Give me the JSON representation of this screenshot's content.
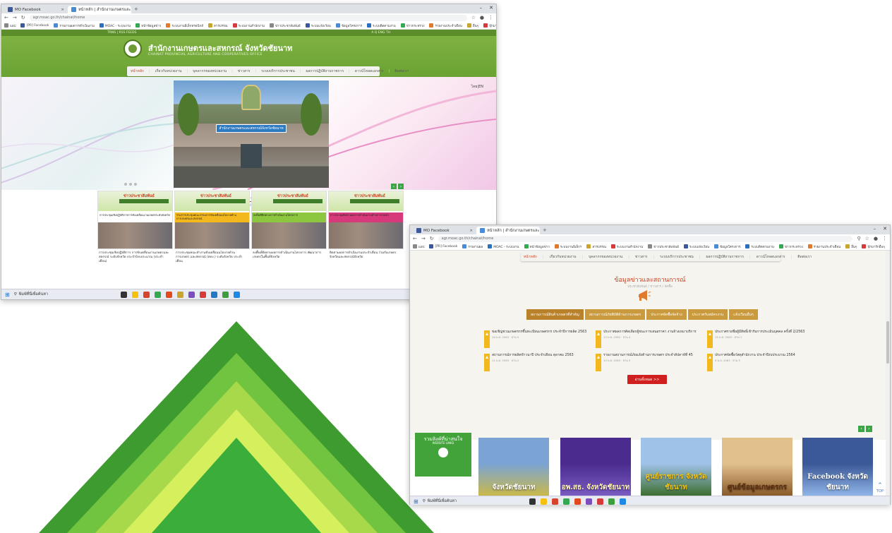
{
  "win1": {
    "tabs": [
      {
        "label": "MO Facebook",
        "active": false,
        "color": "#3b5998"
      },
      {
        "label": "หน้าหลัก | สำนักงานเกษตรและสหกรณ์",
        "active": true,
        "color": "#4a8bd6"
      }
    ],
    "url": "agr.moac.go.th/chainat/home",
    "bookmarks": [
      "แอป",
      "[PR] Facebook",
      "รายงานผลการดำเนินงาน",
      "MOAC - ระบบงาน",
      "หน้าข้อมูลข่าว",
      "ระบบงานอิเล็กทรอนิกส์",
      "สารบรรณ",
      "ระบบงานสำนักงาน",
      "ข่าวประชาสัมพันธ์",
      "ระบบแจ้งเวียน",
      "ข้อมูลโครงการ",
      "ระบบติดตามงาน",
      "ข่าวกระทรวง",
      "รายงานประจำเดือน",
      "อื่นๆ",
      "บุ๊กมาร์กอื่นๆ"
    ],
    "site": {
      "topstrip_left": "TRNS | RSS FEEDS",
      "topstrip_right": "A Q ENG TH",
      "title": "สำนักงานเกษตรและสหกรณ์ จังหวัดชัยนาท",
      "subtitle": "CHAINAT PROVINCIAL AGRICULTURE AND COOPERATIVES OFFICE",
      "menu": [
        "หน้าหลัก",
        "เกี่ยวกับหน่วยงาน",
        "บุคลากรของหน่วยงาน",
        "ข่าวสาร",
        "ระบบบริการประชาชน",
        "ผลการปฏิบัติงานราชการ",
        "ดาวน์โหลดเอกสาร",
        "ติดต่อเรา"
      ],
      "lang": "ไทย|EN",
      "photo_sign": "สำนักงานเกษตรและสหกรณ์จังหวัดชัยนาท",
      "news_title": "ข่าวประชาสัมพันธ์",
      "news_sub": "NEWS",
      "cards": [
        {
          "banner": "ข่าวประชาสัมพันธ์",
          "strip": "การประชุมเชิงปฏิบัติการการขับเคลื่อนงานเกษตรระดับจังหวัด",
          "strip_color": "#ffffff",
          "caption": "การประชุมเชิงปฏิบัติการ การขับเคลื่อนงานเกษตรและสหกรณ์ ระดับจังหวัด ประจำปีงบประมาณ (ประจำเดือน)"
        },
        {
          "banner": "ข่าวประชาสัมพันธ์",
          "strip": "ร่วมการประชุมคณะกรรมการขับเคลื่อนนโยบายด้านการเกษตรและสหกรณ์",
          "strip_color": "#f3b81d",
          "caption": "การประชุมคณะทำงานขับเคลื่อนนโยบายด้านการเกษตร และสหกรณ์ (คทง.) ระดับจังหวัด ประจำเดือน"
        },
        {
          "banner": "ข่าวประชาสัมพันธ์",
          "strip": "ลงพื้นที่ติดตามการดำเนินงานโครงการ",
          "strip_color": "#8dc63f",
          "caption": "ลงพื้นที่ติดตามผลการดำเนินงานโครงการ พัฒนาการเกษตรในพื้นที่จังหวัด"
        },
        {
          "banner": "ข่าวประชาสัมพันธ์",
          "strip": "การประชุมติดตามผลการดำเนินงานด้านการเกษตร",
          "strip_color": "#d63a7a",
          "caption": "ติดตามผลการดำเนินงานประจำเดือน ร่วมกับเกษตรจังหวัดและสหกรณ์จังหวัด"
        }
      ]
    },
    "taskbar_search": "พิมพ์ที่นี่เพื่อค้นหา"
  },
  "win2": {
    "tabs": [
      {
        "label": "MO Facebook",
        "active": false,
        "color": "#3b5998"
      },
      {
        "label": "หน้าหลัก | สำนักงานเกษตรและสหกรณ์",
        "active": true,
        "color": "#4a8bd6"
      }
    ],
    "url": "agr.moac.go.th/chainat/home",
    "bookmarks": [
      "แอป",
      "[PR] Facebook",
      "รายงานผล",
      "MOAC - ระบบงาน",
      "หน้าข้อมูลข่าว",
      "ระบบงานอิเล็กฯ",
      "สารบรรณ",
      "ระบบงานสำนักงาน",
      "ข่าวประชาสัมพันธ์",
      "ระบบแจ้งเวียน",
      "ข้อมูลโครงการ",
      "ระบบติดตามงาน",
      "ข่าวกระทรวง",
      "รายงานประจำเดือน",
      "อื่นๆ",
      "บุ๊กมาร์กอื่นๆ"
    ],
    "site": {
      "menu": [
        "หน้าหลัก",
        "เกี่ยวกับหน่วยงาน",
        "บุคลากรของหน่วยงาน",
        "ข่าวสาร",
        "ระบบบริการประชาชน",
        "ผลการปฏิบัติงานราชการ",
        "ดาวน์โหลดเอกสาร",
        "ติดต่อเรา"
      ],
      "pr_title": "ข้อมูลข่าวและสถานการณ์",
      "pr_sub": "ประชาสัมพันธ์ / ข่าวสาร / จัดซื้อ",
      "tabs": [
        "สถานการณ์สินค้าเกษตรที่สำคัญ",
        "สถานการณ์ภัยพิบัติด้านการเกษตร",
        "ประกาศจัดซื้อจัดจ้าง",
        "ประกาศรับสมัครงาน",
        "แจ้งเวียนอื่นๆ"
      ],
      "items": [
        {
          "text": "ขอเชิญชวนเกษตรกรขึ้นทะเบียนเกษตรกร ประจำปีการผลิต 2563",
          "meta": "16 พ.ย. 2563 · อ่าน 0"
        },
        {
          "text": "ประกาศผลการคัดเลือกผู้ชนะการเสนอราคา งานจ้างเหมาบริการ",
          "meta": "13 พ.ย. 2563 · อ่าน 4"
        },
        {
          "text": "ประกาศรายชื่อผู้มีสิทธิ์เข้ารับการประเมินบุคคล ครั้งที่ 2/2563",
          "meta": "15 พ.ย. 2563 · อ่าน 1"
        },
        {
          "text": "สถานการณ์การผลิตข้าวนาปี ประจำเดือน ตุลาคม 2563",
          "meta": "11 พ.ย. 2563 · อ่าน 2"
        },
        {
          "text": "รายงานสถานการณ์ภัยแล้งด้านการเกษตร ประจำสัปดาห์ที่ 45",
          "meta": "10 พ.ย. 2563 · อ่าน 3"
        },
        {
          "text": "ประกาศจัดซื้อวัสดุสำนักงาน ประจำปีงบประมาณ 2564",
          "meta": "9 พ.ย. 2563 · อ่าน 5"
        }
      ],
      "more_button": "อ่านทั้งหมด >>",
      "links_title": "รวมลิงค์ที่น่าสนใจ",
      "links_sub": "WEBSITE LINKS",
      "thumbs": [
        {
          "label": "จังหวัดชัยนาท",
          "top": "#7ba4d4",
          "bottom": "#c9b84a",
          "text_color": "#ffffff"
        },
        {
          "label": "อพ.สธ. จังหวัดชัยนาท",
          "top": "#4b2c8e",
          "bottom": "#7a5bc2",
          "text_color": "#fff4b0"
        },
        {
          "label": "ศูนย์ราชการ จังหวัดชัยนาท",
          "top": "#9fc2e8",
          "bottom": "#3d6e30",
          "text_color": "#f4c20d"
        },
        {
          "label": "ศูนย์ข้อมูลเกษตรกร",
          "top": "#e2c08b",
          "bottom": "#8a5a2b",
          "text_color": "#5a2d0c"
        },
        {
          "label": "Facebook จังหวัดชัยนาท",
          "top": "#3b5998",
          "bottom": "#8fb4e6",
          "text_color": "#ffffff"
        }
      ],
      "top_label": "TOP"
    },
    "taskbar_search": "พิมพ์ที่นี่เพื่อค้นหา"
  }
}
